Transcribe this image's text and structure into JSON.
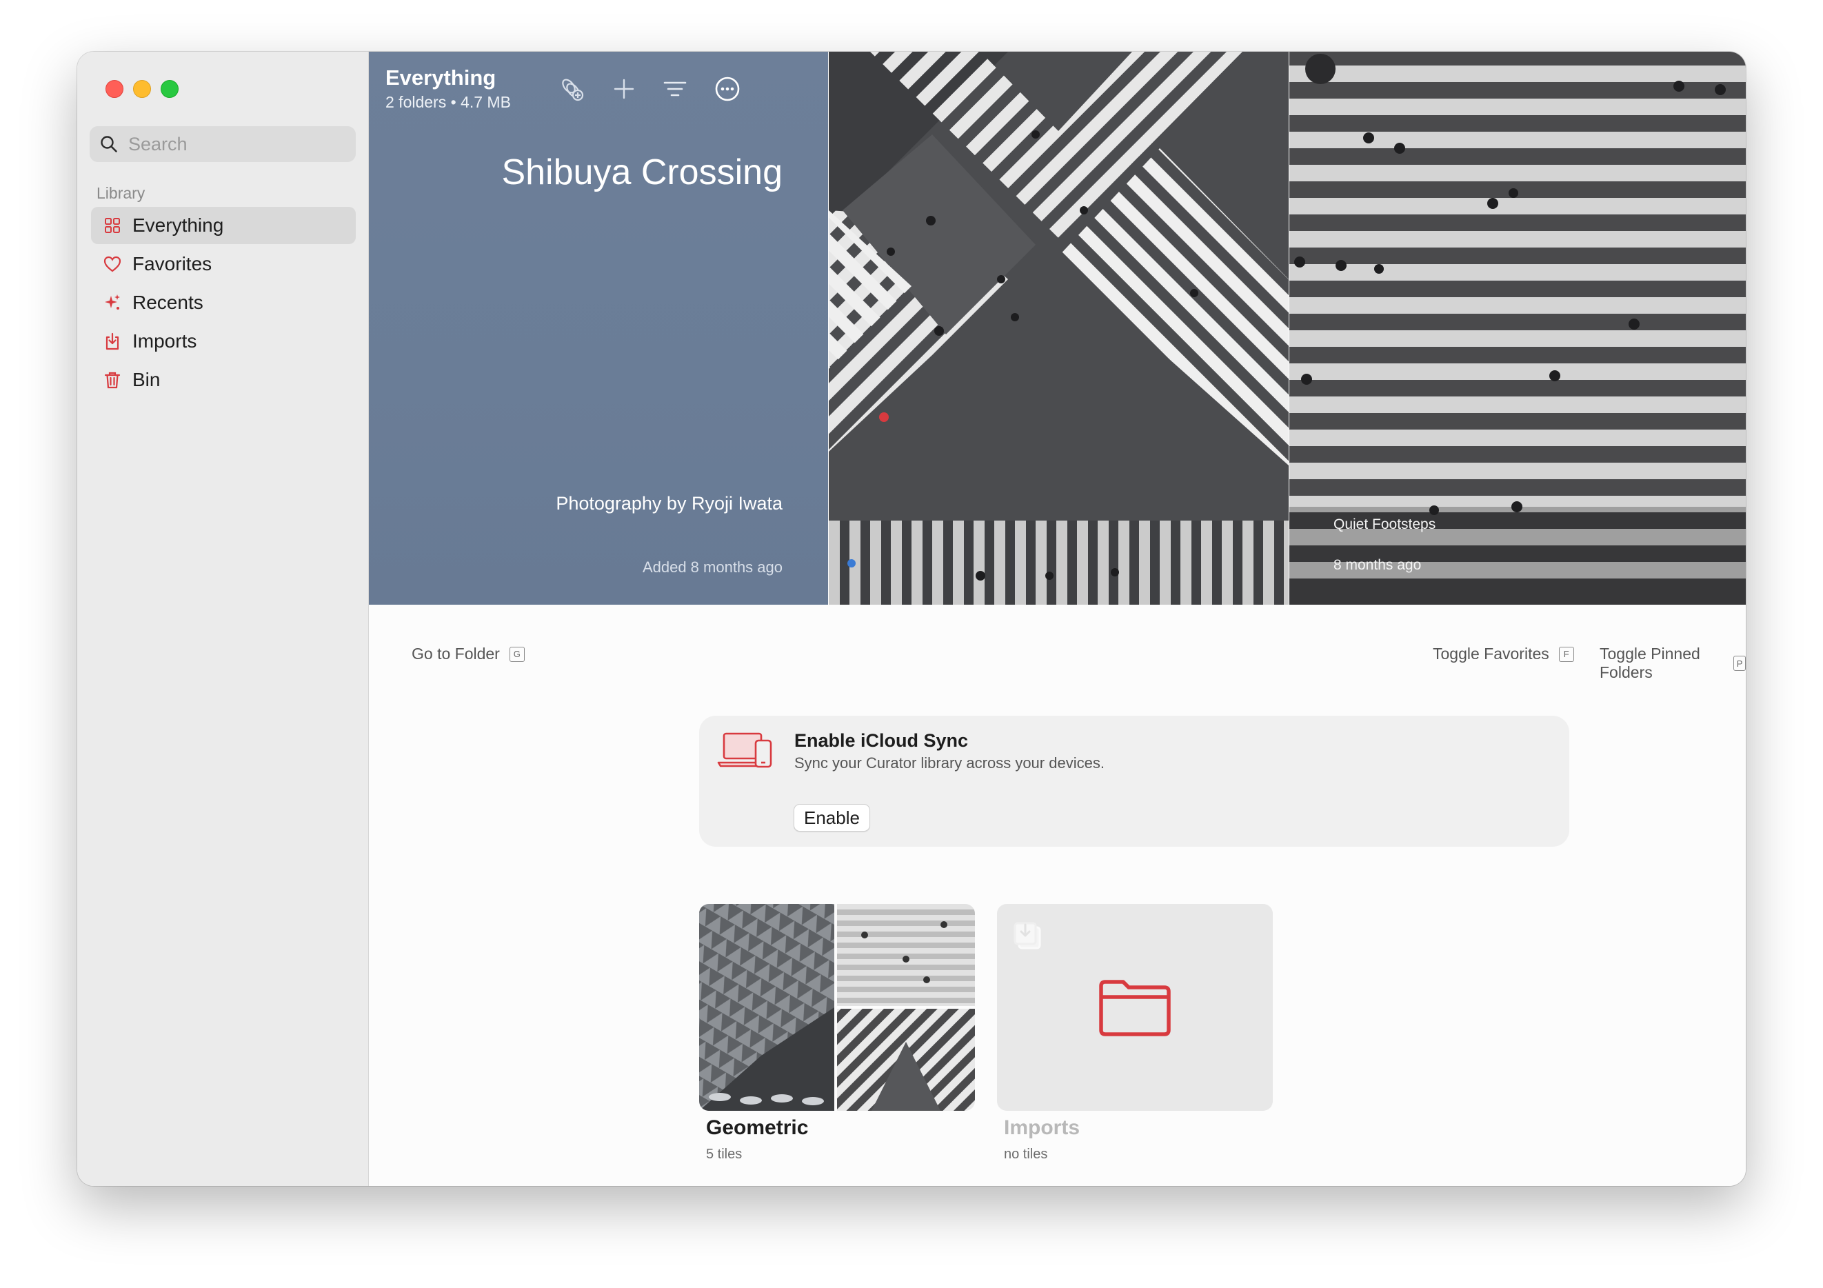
{
  "sidebar": {
    "search_placeholder": "Search",
    "section_label": "Library",
    "items": [
      {
        "label": "Everything",
        "icon": "grid-icon",
        "active": true
      },
      {
        "label": "Favorites",
        "icon": "heart-icon",
        "active": false
      },
      {
        "label": "Recents",
        "icon": "sparkle-icon",
        "active": false
      },
      {
        "label": "Imports",
        "icon": "import-icon",
        "active": false
      },
      {
        "label": "Bin",
        "icon": "trash-icon",
        "active": false
      }
    ]
  },
  "header": {
    "title": "Everything",
    "subtitle": "2 folders • 4.7 MB"
  },
  "hero": {
    "title": "Shibuya Crossing",
    "credit": "Photography by Ryoji Iwata",
    "added": "Added 8 months ago"
  },
  "photo2": {
    "caption": "Quiet Footsteps",
    "added": "8 months ago"
  },
  "shortcuts": {
    "go_to_folder": "Go to Folder",
    "go_to_folder_key": "G",
    "toggle_favorites": "Toggle Favorites",
    "toggle_favorites_key": "F",
    "toggle_pinned": "Toggle Pinned Folders",
    "toggle_pinned_key": "P"
  },
  "sync": {
    "title": "Enable iCloud Sync",
    "description": "Sync your Curator library across your devices.",
    "button": "Enable"
  },
  "folders": [
    {
      "name": "Geometric",
      "count": "5 tiles"
    },
    {
      "name": "Imports",
      "count": "no tiles"
    }
  ],
  "colors": {
    "accent": "#d83a3f",
    "hero_panel": "#6d7f99",
    "sidebar_bg": "#ebebeb"
  }
}
